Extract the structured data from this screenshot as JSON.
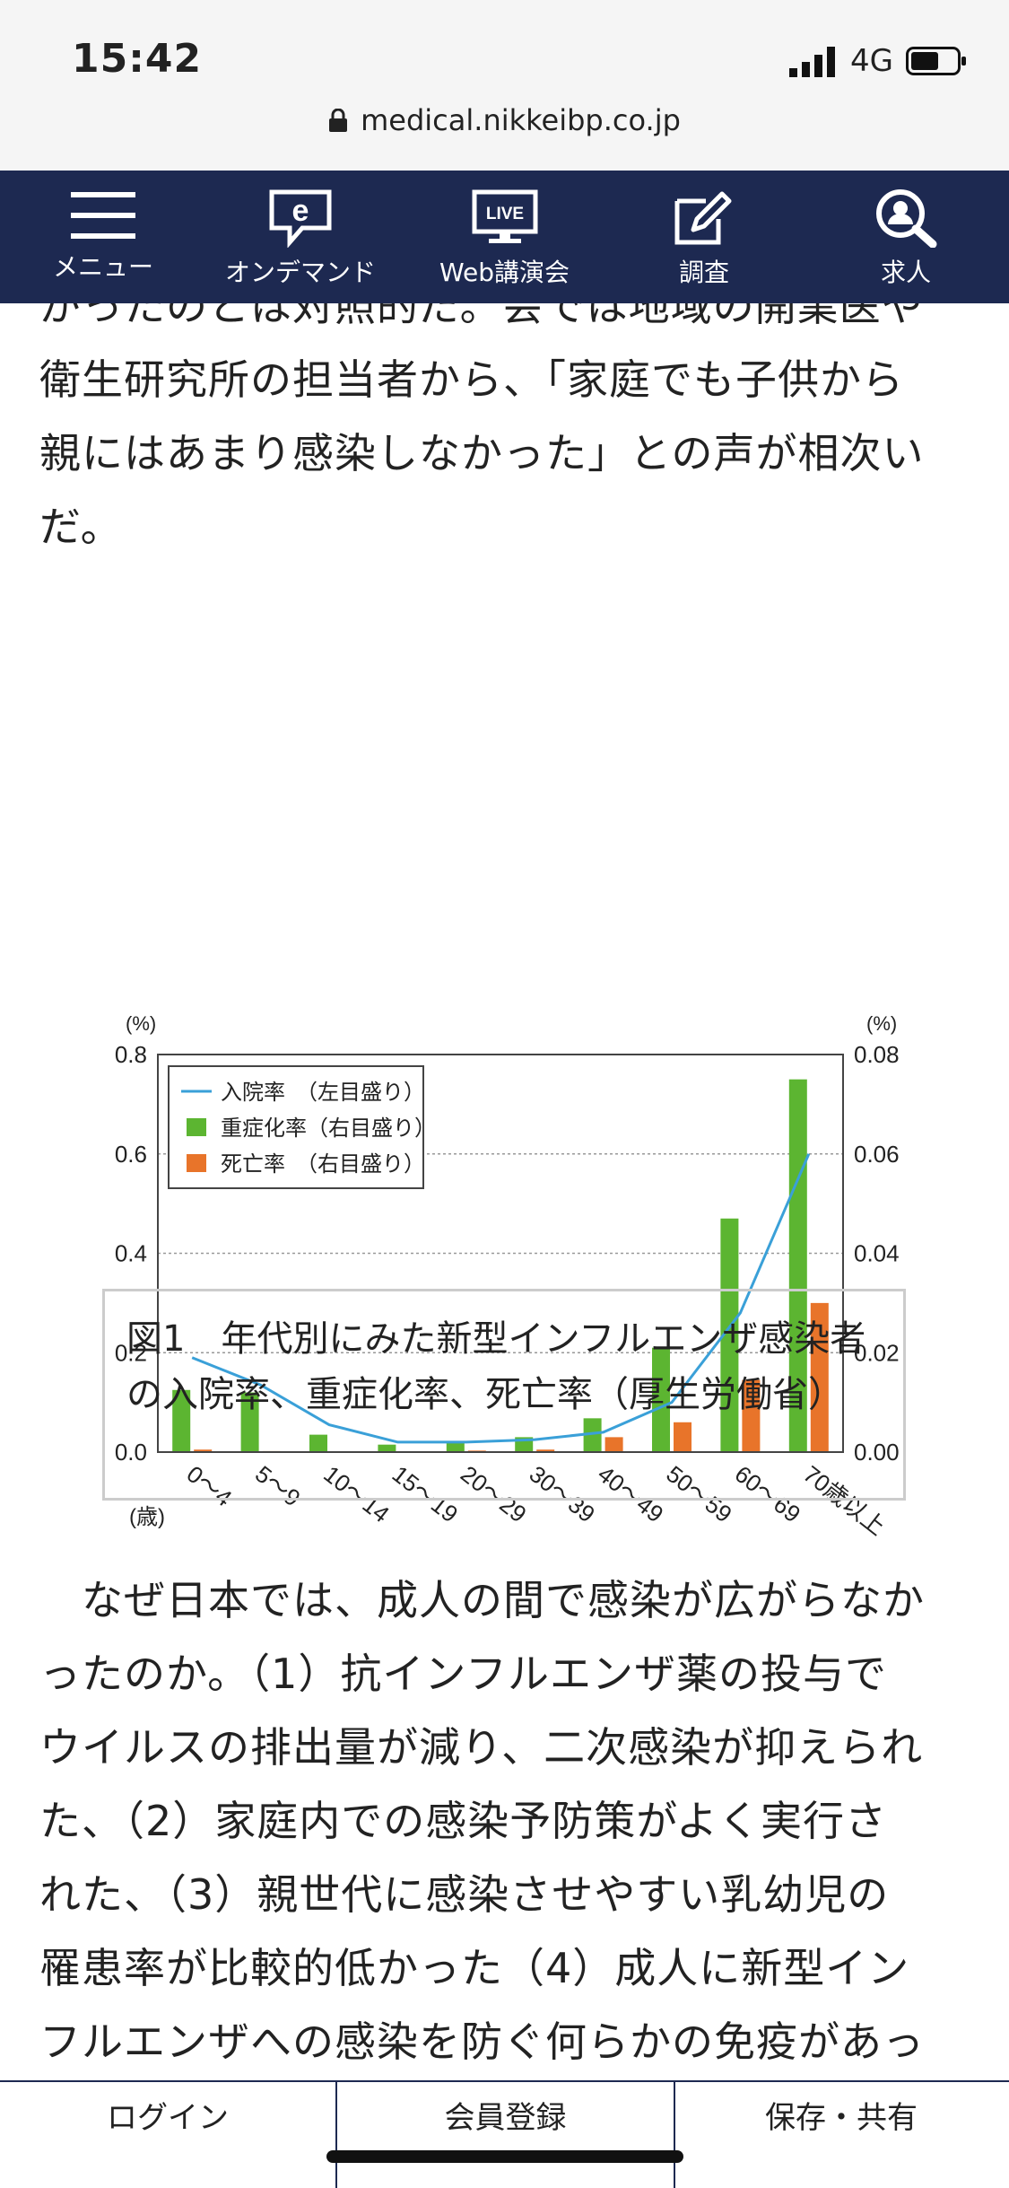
{
  "status": {
    "time": "15:42",
    "network": "4G"
  },
  "browser": {
    "url": "medical.nikkeibp.co.jp"
  },
  "nav": {
    "items": [
      {
        "label": "メニュー",
        "icon": "menu-icon"
      },
      {
        "label": "オンデマンド",
        "icon": "e-chat-icon",
        "glyph": "e"
      },
      {
        "label": "Web講演会",
        "icon": "live-monitor-icon",
        "glyph": "LIVE"
      },
      {
        "label": "調査",
        "icon": "edit-icon"
      },
      {
        "label": "求人",
        "icon": "search-person-icon"
      }
    ]
  },
  "article": {
    "para1_lines": [
      "がったのとは対照的だ。会では地域の開業医や",
      "衛生研究所の担当者から、「家庭でも子供から",
      "親にはあまり感染しなかった」との声が相次い",
      "だ。"
    ],
    "figure_caption": "図1　年代別にみた新型インフルエンザ感染者の入院率、重症化率、死亡率（厚生労働省）",
    "para2_lines": [
      "　なぜ日本では、成人の間で感染が広がらなか",
      "ったのか。（1）抗インフルエンザ薬の投与で",
      "ウイルスの排出量が減り、二次感染が抑えられ",
      "た、（2）家庭内での感染予防策がよく実行さ",
      "れた、（3）親世代に感染させやすい乳幼児の",
      "罹患率が比較的低かった（4）成人に新型イン",
      "フルエンザへの感染を防ぐ何らかの免疫があっ"
    ]
  },
  "chart_data": {
    "type": "bar",
    "categories": [
      "0～4",
      "5～9",
      "10～14",
      "15～19",
      "20～29",
      "30～39",
      "40～49",
      "50～59",
      "60～69",
      "70歳以上"
    ],
    "x_unit_label": "(歳)",
    "left_axis": {
      "unit": "(%)",
      "ylim": [
        0,
        0.8
      ],
      "ticks": [
        "0.0",
        "0.2",
        "0.4",
        "0.6",
        "0.8"
      ]
    },
    "right_axis": {
      "unit": "(%)",
      "ylim": [
        0,
        0.08
      ],
      "ticks": [
        "0.00",
        "0.02",
        "0.04",
        "0.06",
        "0.08"
      ]
    },
    "series": [
      {
        "name": "入院率　（左目盛り）",
        "kind": "line",
        "axis": "left",
        "color": "#3aa0d8",
        "values": [
          0.19,
          0.135,
          0.055,
          0.02,
          0.02,
          0.025,
          0.04,
          0.1,
          0.28,
          0.6
        ]
      },
      {
        "name": "重症化率（右目盛り）",
        "kind": "bar",
        "axis": "right",
        "color": "#5cb531",
        "values": [
          0.0125,
          0.012,
          0.0035,
          0.0015,
          0.002,
          0.003,
          0.0068,
          0.021,
          0.047,
          0.075
        ]
      },
      {
        "name": "死亡率　（右目盛り）",
        "kind": "bar",
        "axis": "right",
        "color": "#e8742a",
        "values": [
          0.0005,
          0.0002,
          0.0001,
          0.0001,
          0.0003,
          0.0005,
          0.003,
          0.006,
          0.0145,
          0.03
        ]
      }
    ],
    "grid": true,
    "legend": "top-left"
  },
  "bottom": {
    "tabs": [
      "ログイン",
      "会員登録",
      "保存・共有"
    ]
  }
}
